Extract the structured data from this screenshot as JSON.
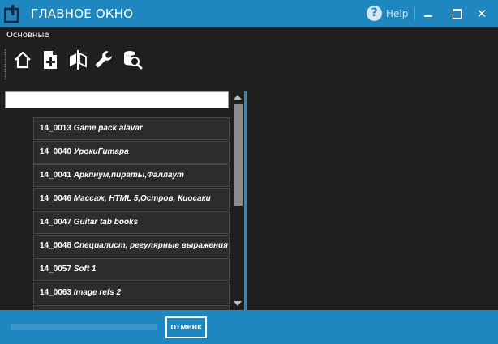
{
  "window": {
    "title": "ГЛАВНОЕ ОКНО",
    "help_label": "Help",
    "close_glyph": "✕",
    "accent_color": "#1e87c0"
  },
  "ribbon": {
    "group_label": "Основные",
    "tools": [
      {
        "icon": "home-icon"
      },
      {
        "icon": "add-document-icon"
      },
      {
        "icon": "compare-icon"
      },
      {
        "icon": "wrench-icon"
      },
      {
        "icon": "database-search-icon"
      }
    ]
  },
  "search": {
    "value": "",
    "placeholder": ""
  },
  "list": {
    "items": [
      {
        "code": "14_0013",
        "name": "Game pack alavar"
      },
      {
        "code": "14_0040",
        "name": "УрокиГитара"
      },
      {
        "code": "14_0041",
        "name": "Аркпнум,пираты,Фаллаут"
      },
      {
        "code": "14_0046",
        "name": "Массаж, HTML 5,Остров, Киосаки"
      },
      {
        "code": "14_0047",
        "name": "Guitar tab books"
      },
      {
        "code": "14_0048",
        "name": "Специалист, регулярные выражения"
      },
      {
        "code": "14_0057",
        "name": "Soft 1"
      },
      {
        "code": "14_0063",
        "name": "Image refs 2"
      },
      {
        "code": "",
        "name": ""
      }
    ]
  },
  "footer": {
    "cancel_label": "отменк",
    "progress": 0
  }
}
